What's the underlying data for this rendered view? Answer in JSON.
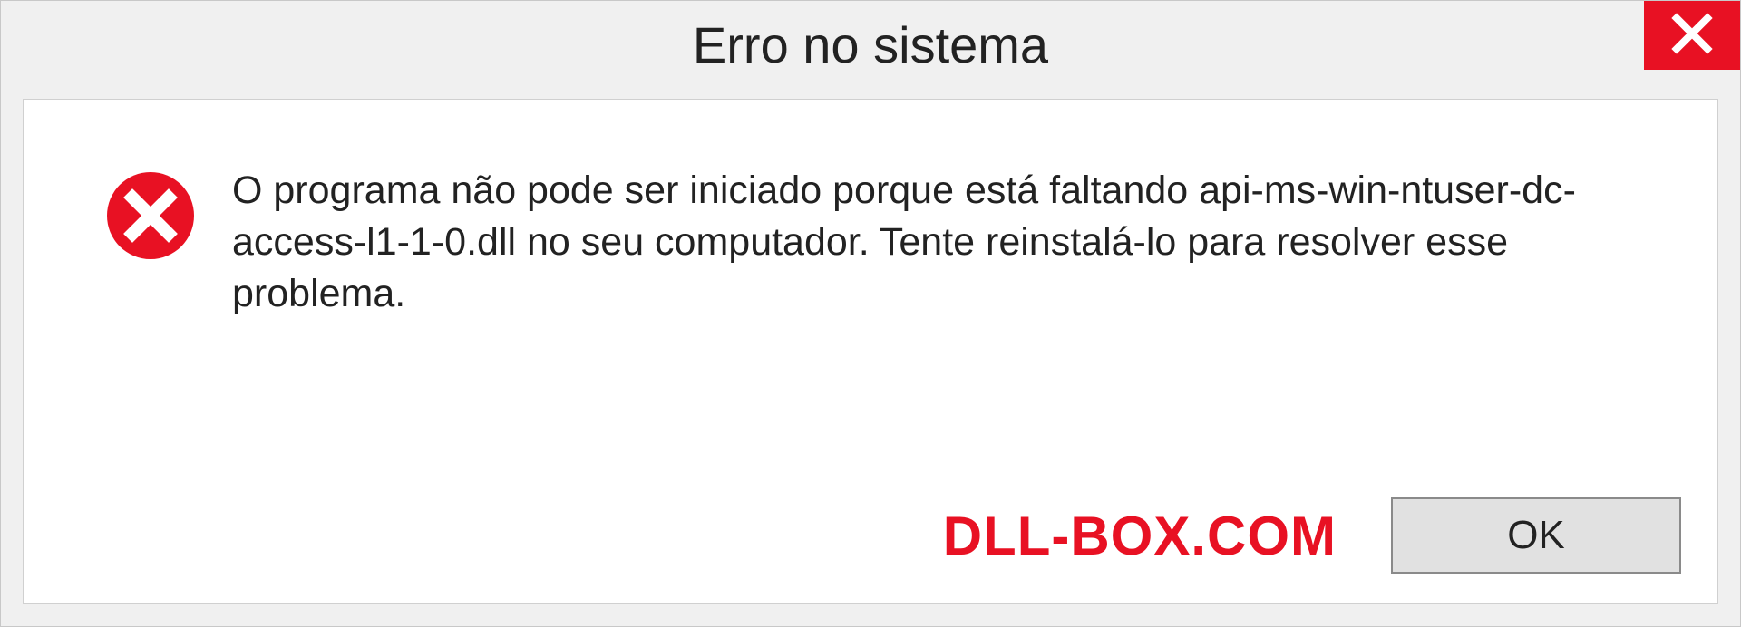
{
  "dialog": {
    "title": "Erro no sistema",
    "message": "O programa não pode ser iniciado porque está faltando api-ms-win-ntuser-dc-access-l1-1-0.dll no seu computador. Tente reinstalá-lo para resolver esse problema.",
    "ok_label": "OK",
    "watermark": "DLL-BOX.COM"
  },
  "colors": {
    "error_red": "#e81123",
    "panel_bg": "#ffffff",
    "window_bg": "#f0f0f0",
    "button_bg": "#e1e1e1"
  }
}
